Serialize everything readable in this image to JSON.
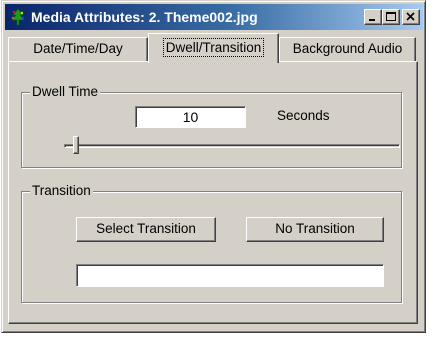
{
  "window": {
    "title": "Media Attributes: 2. Theme002.jpg",
    "icon": "tree-icon",
    "controls": [
      "minimize-icon",
      "maximize-icon",
      "close-icon"
    ]
  },
  "tabs": [
    {
      "label": "Date/Time/Day",
      "selected": false
    },
    {
      "label": "Dwell/Transition",
      "selected": true
    },
    {
      "label": "Background Audio",
      "selected": false
    }
  ],
  "dwell": {
    "group_label": "Dwell Time",
    "value": "10",
    "unit_label": "Seconds",
    "slider_level": 0.03
  },
  "transition": {
    "group_label": "Transition",
    "select_button": "Select Transition",
    "none_button": "No Transition",
    "current_value": ""
  },
  "colors": {
    "face": "#d4d0c8",
    "title_start": "#0a246a",
    "title_end": "#a6caf0"
  }
}
